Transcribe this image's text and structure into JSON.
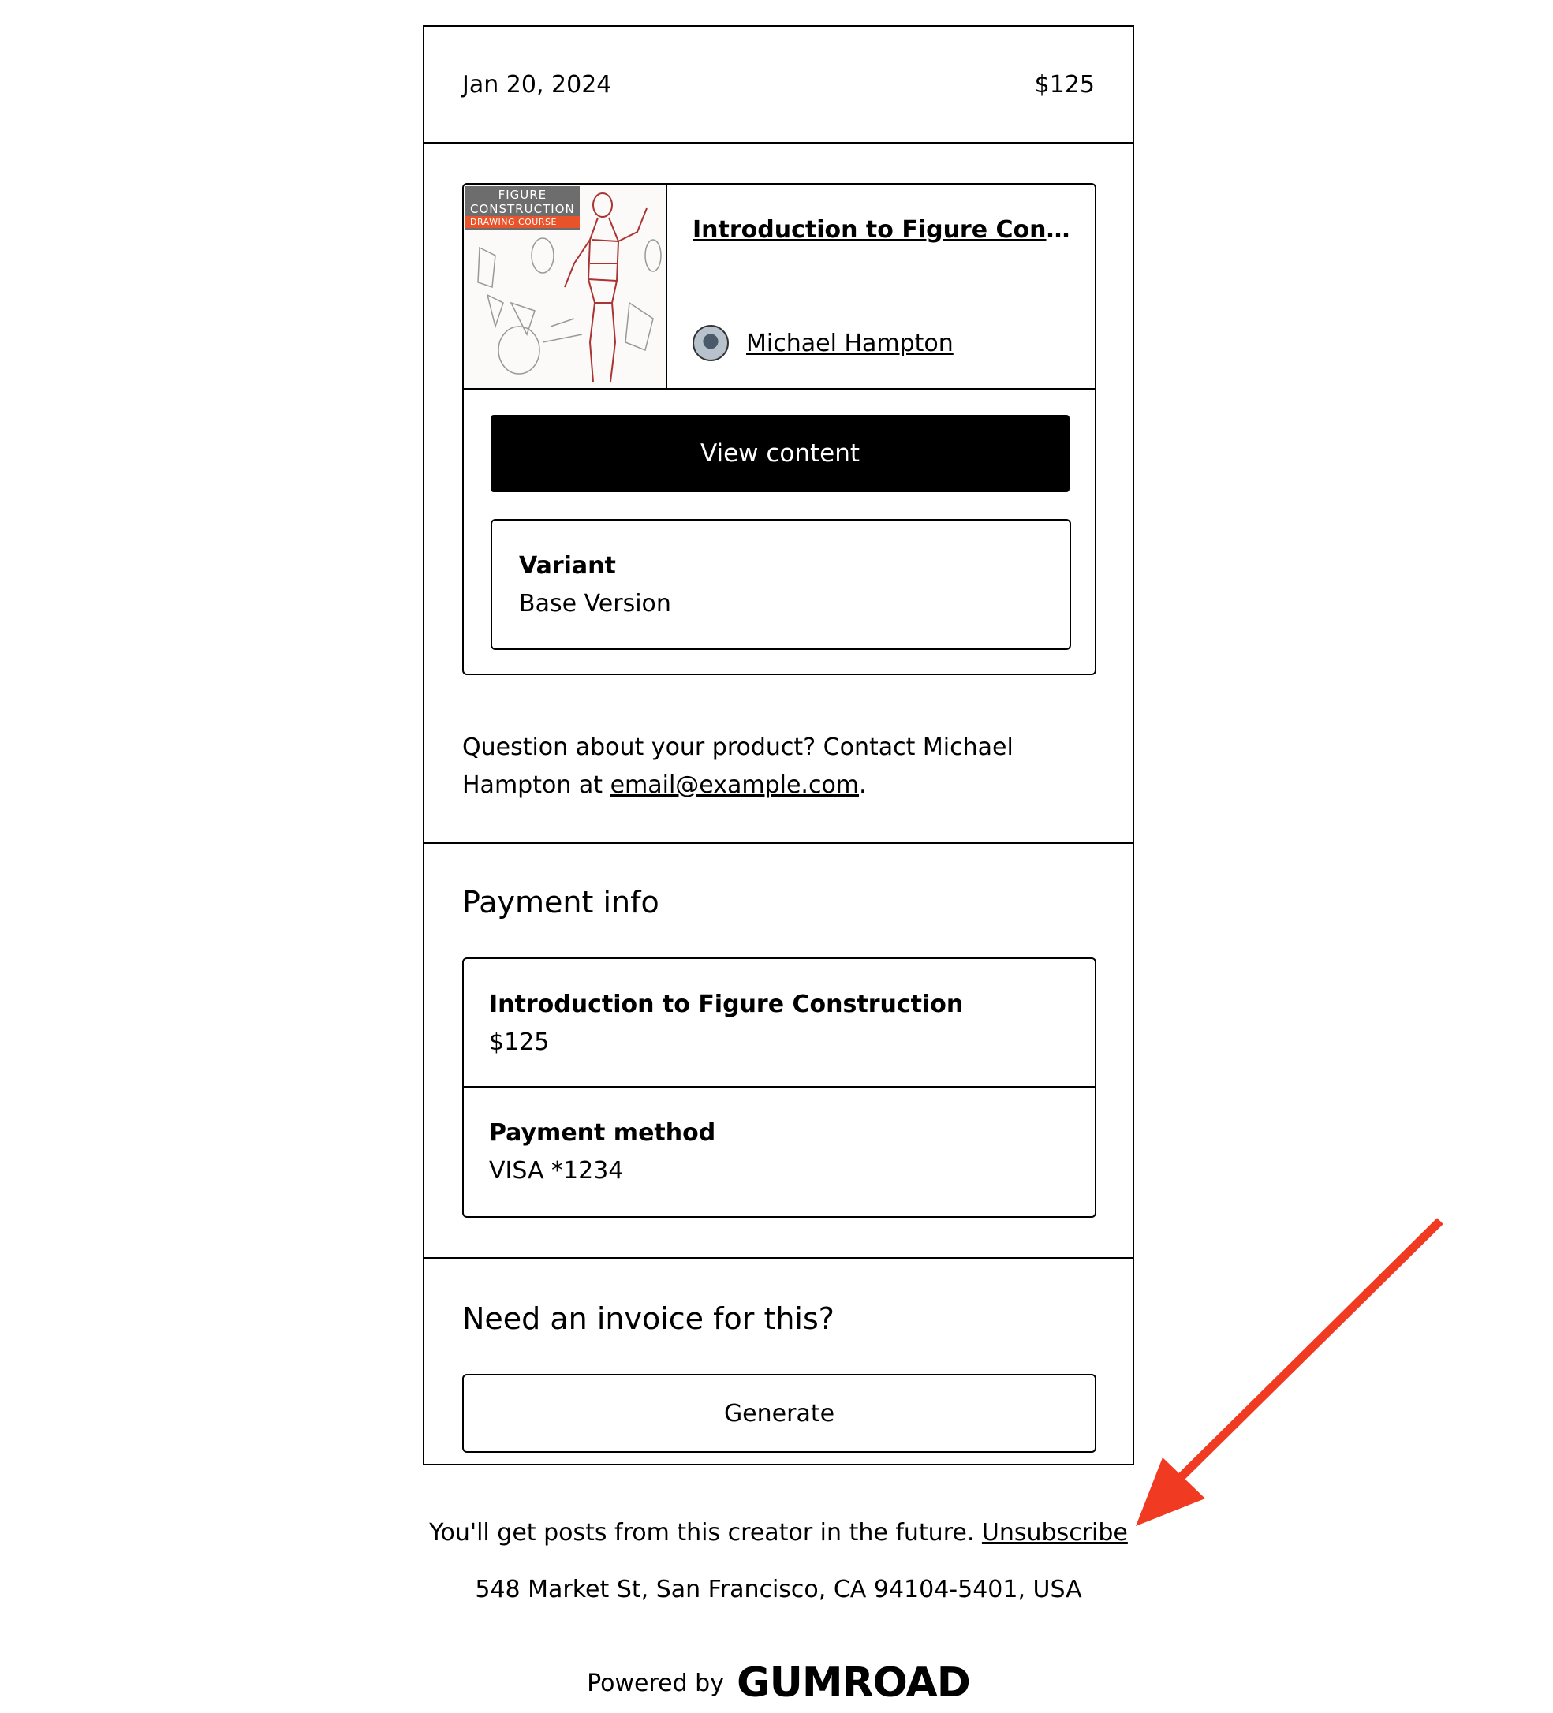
{
  "header": {
    "date": "Jan 20, 2024",
    "price": "$125"
  },
  "product": {
    "thumbnail": {
      "title_line1": "FIGURE",
      "title_line2": "CONSTRUCTION",
      "subtitle": "DRAWING COURSE"
    },
    "title": "Introduction to Figure Const...",
    "creator_name": "Michael Hampton",
    "view_button_label": "View content",
    "variant_label": "Variant",
    "variant_value": "Base Version",
    "question_prefix": "Question about your product? Contact Michael Hampton at ",
    "contact_email": "email@example.com",
    "question_suffix": "."
  },
  "payment": {
    "title": "Payment info",
    "item_name": "Introduction to Figure Construction",
    "item_price": "$125",
    "method_label": "Payment method",
    "method_value": "VISA *1234"
  },
  "invoice": {
    "title": "Need an invoice for this?",
    "button_label": "Generate"
  },
  "footer": {
    "subscribe_text": "You'll get posts from this creator in the future. ",
    "unsubscribe_link": "Unsubscribe",
    "address": "548 Market St, San Francisco, CA 94104-5401, USA",
    "powered_by": "Powered by",
    "brand": "GUMROAD"
  },
  "annotation": {
    "arrow_color": "#f03a22"
  },
  "colors": {
    "primary_button_bg": "#000000",
    "primary_button_text": "#ffffff",
    "thumbnail_badge": "#e8532a"
  }
}
